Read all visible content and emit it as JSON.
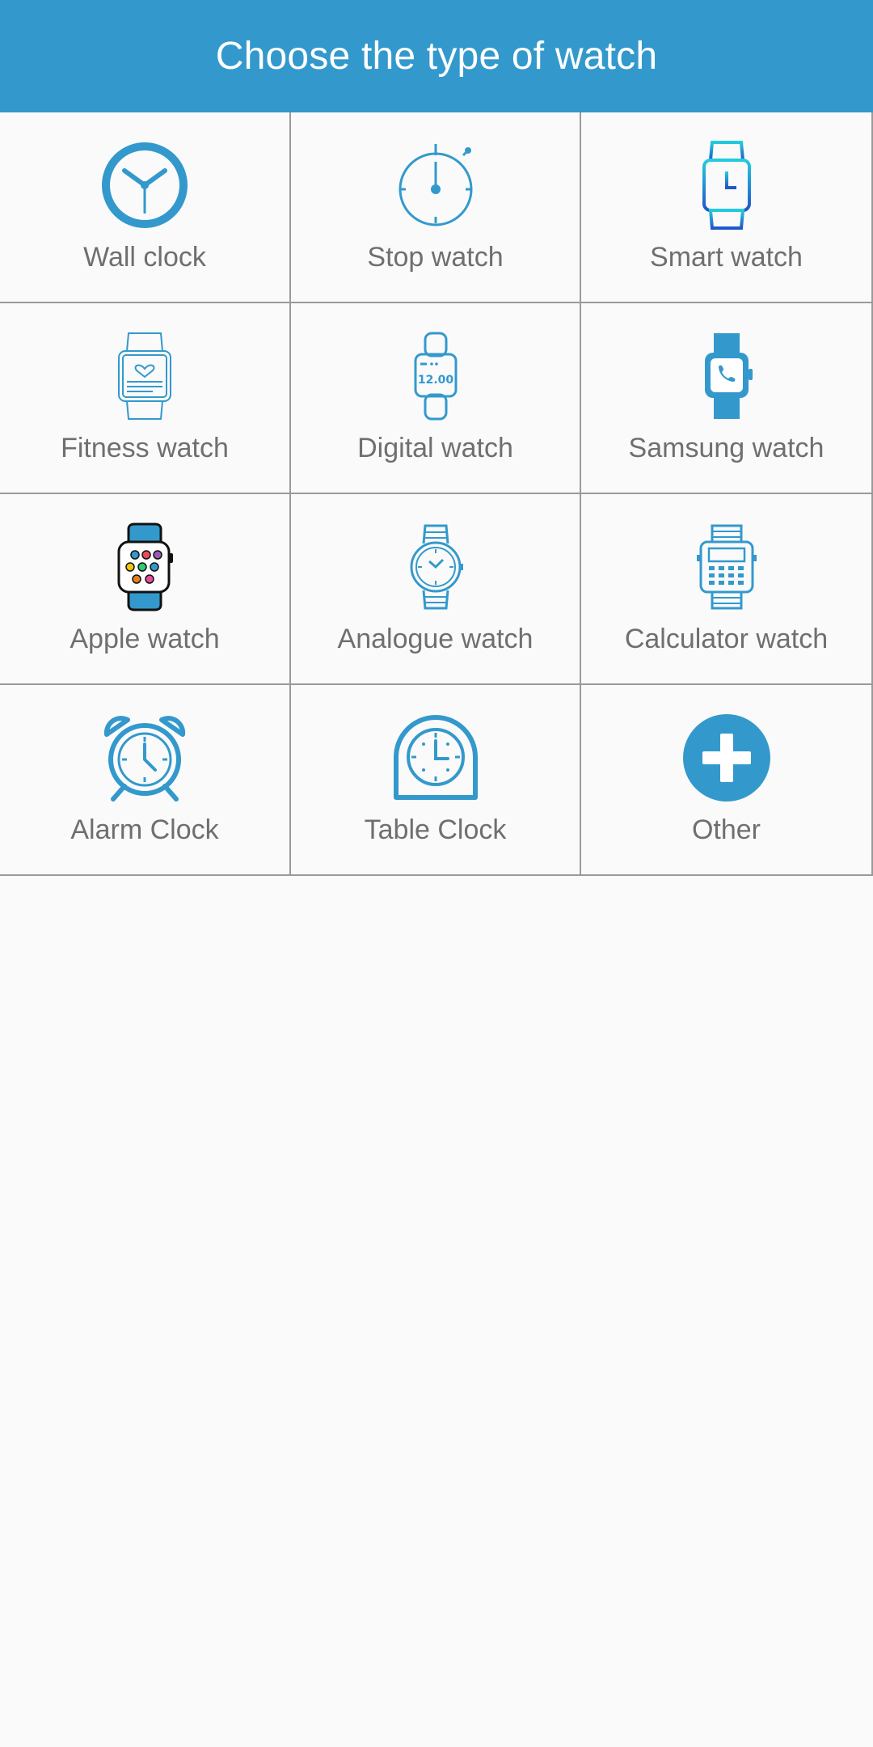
{
  "header": {
    "title": "Choose the type of watch"
  },
  "colors": {
    "app_bar": "#3399cc",
    "icon_blue": "#3399cc",
    "label_gray": "#6f6f6f",
    "divider": "#9a9a9a"
  },
  "options": [
    {
      "label": "Wall clock",
      "icon": "wall-clock-icon"
    },
    {
      "label": "Stop watch",
      "icon": "stopwatch-icon"
    },
    {
      "label": "Smart watch",
      "icon": "smartwatch-icon"
    },
    {
      "label": "Fitness watch",
      "icon": "fitness-watch-icon"
    },
    {
      "label": "Digital watch",
      "icon": "digital-watch-icon"
    },
    {
      "label": "Samsung watch",
      "icon": "samsung-watch-icon"
    },
    {
      "label": "Apple watch",
      "icon": "apple-watch-icon"
    },
    {
      "label": "Analogue watch",
      "icon": "analogue-watch-icon"
    },
    {
      "label": "Calculator watch",
      "icon": "calculator-watch-icon"
    },
    {
      "label": "Alarm Clock",
      "icon": "alarm-clock-icon"
    },
    {
      "label": "Table Clock",
      "icon": "table-clock-icon"
    },
    {
      "label": "Other",
      "icon": "add-icon"
    }
  ],
  "digital_watch_display": "12.00"
}
